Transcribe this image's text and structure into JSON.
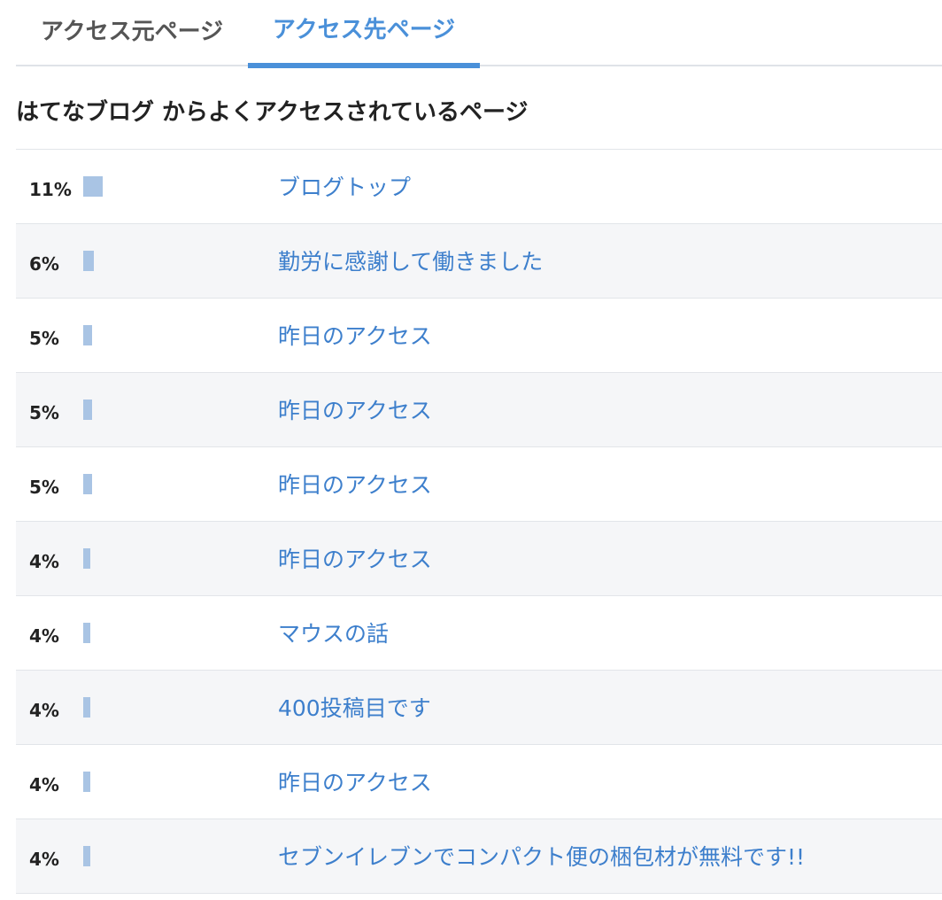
{
  "tabs": [
    {
      "label": "アクセス元ページ",
      "active": false
    },
    {
      "label": "アクセス先ページ",
      "active": true
    }
  ],
  "heading": "はてなブログ からよくアクセスされているページ",
  "colors": {
    "accent": "#4a90d9",
    "link": "#3d7fcc",
    "bar": "#a9c4e4",
    "row_alt": "#f5f6f8"
  },
  "rows": [
    {
      "percent": "11%",
      "share": 0.11,
      "title": "ブログトップ"
    },
    {
      "percent": "6%",
      "share": 0.06,
      "title": "勤労に感謝して働きました"
    },
    {
      "percent": "5%",
      "share": 0.05,
      "title": "昨日のアクセス"
    },
    {
      "percent": "5%",
      "share": 0.05,
      "title": "昨日のアクセス"
    },
    {
      "percent": "5%",
      "share": 0.05,
      "title": "昨日のアクセス"
    },
    {
      "percent": "4%",
      "share": 0.04,
      "title": "昨日のアクセス"
    },
    {
      "percent": "4%",
      "share": 0.04,
      "title": "マウスの話"
    },
    {
      "percent": "4%",
      "share": 0.04,
      "title": "400投稿目です"
    },
    {
      "percent": "4%",
      "share": 0.04,
      "title": "昨日のアクセス"
    },
    {
      "percent": "4%",
      "share": 0.04,
      "title": "セブンイレブンでコンパクト便の梱包材が無料です!!"
    }
  ]
}
